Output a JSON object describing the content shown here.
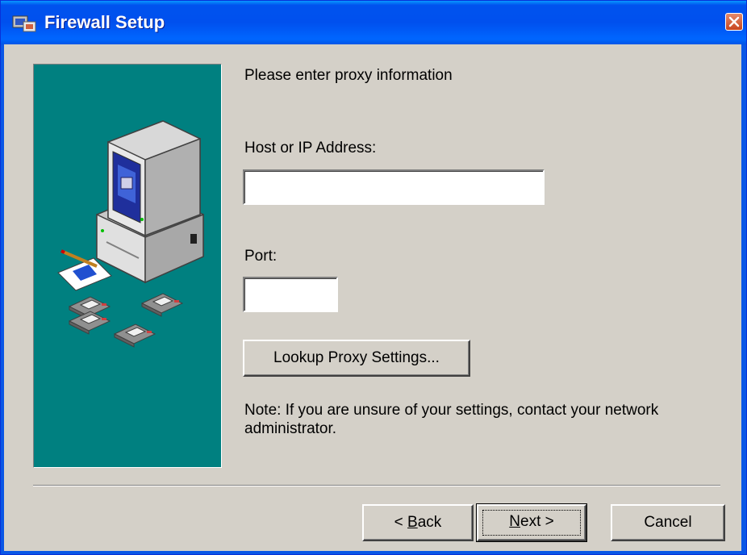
{
  "window": {
    "title": "Firewall Setup",
    "icon": "setup-app-icon",
    "close_icon": "close-icon"
  },
  "content": {
    "heading": "Please enter proxy information",
    "host_label": "Host or IP Address:",
    "host_value": "",
    "port_label": "Port:",
    "port_value": "",
    "lookup_button": "Lookup Proxy Settings...",
    "note": "Note: If you are unsure of your settings, contact your network administrator."
  },
  "buttons": {
    "back_prefix": "< ",
    "back_mnemonic": "B",
    "back_rest": "ack",
    "next_mnemonic": "N",
    "next_rest": "ext >",
    "cancel": "Cancel"
  },
  "side_panel": {
    "illustration": "computer-with-disks-illustration",
    "background": "#008080"
  },
  "colors": {
    "titlebar": "#0054e3",
    "dialog_face": "#d4d0c8",
    "close_button": "#c8451f"
  }
}
